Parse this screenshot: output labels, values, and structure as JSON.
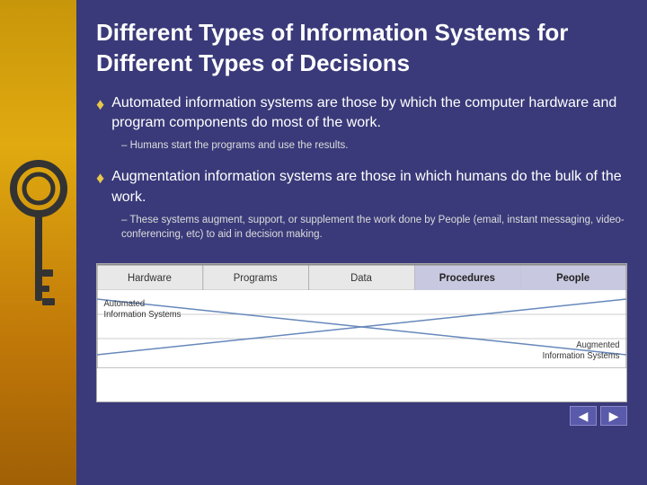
{
  "slide": {
    "title_line1": "Different Types of Information Systems for",
    "title_line2": "Different Types of Decisions",
    "bullet1": {
      "text": "Automated information systems are those by which the computer hardware and program components do most of the work.",
      "sub": "– Humans start the programs and use the results."
    },
    "bullet2": {
      "text": "Augmentation information systems are those in which humans do the bulk of the work.",
      "sub": "– These systems augment, support, or supplement the work done by People (email, instant messaging, video-conferencing, etc) to aid in decision making."
    },
    "diagram": {
      "columns": [
        "Hardware",
        "Programs",
        "Data",
        "Procedures",
        "People"
      ],
      "highlighted_cols": [
        "Procedures",
        "People"
      ],
      "label_left_line1": "Automated",
      "label_left_line2": "Information Systems",
      "label_right_line1": "Augmented",
      "label_right_line2": "Information Systems"
    },
    "nav": {
      "prev": "◀",
      "next": "▶"
    }
  }
}
